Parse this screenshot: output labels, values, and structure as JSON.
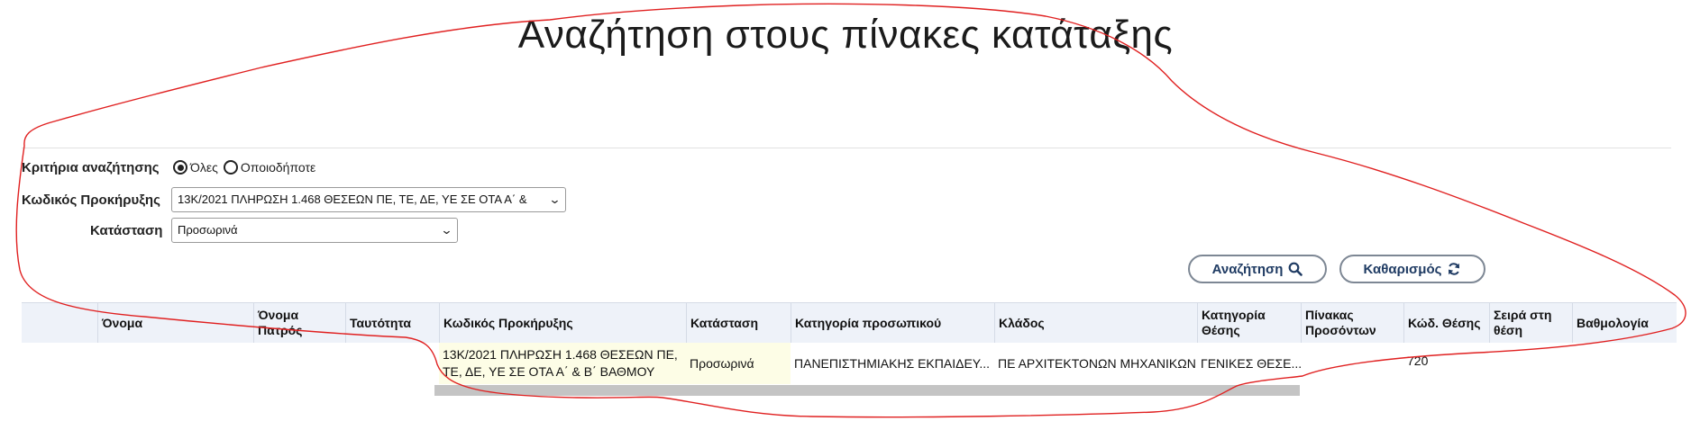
{
  "page": {
    "title": "Αναζήτηση στους πίνακες κατάταξης"
  },
  "form": {
    "criteria_label": "Κριτήρια αναζήτησης",
    "criteria_options": [
      {
        "label": "Όλες",
        "selected": true
      },
      {
        "label": "Οποιοδήποτε",
        "selected": false
      }
    ],
    "announcement_label": "Κωδικός Προκήρυξης",
    "announcement_value": "13Κ/2021 ΠΛΗΡΩΣΗ 1.468 ΘΕΣΕΩΝ ΠΕ, ΤΕ, ΔΕ, ΥΕ ΣΕ ΟΤΑ Α΄ &",
    "status_label": "Κατάσταση",
    "status_value": "Προσωρινά",
    "search_button": "Αναζήτηση",
    "clear_button": "Καθαρισμός"
  },
  "table": {
    "columns": [
      "Όνομα",
      "Όνομα Πατρός",
      "Ταυτότητα",
      "Κωδικός Προκήρυξης",
      "Κατάσταση",
      "Κατηγορία προσωπικού",
      "Κλάδος",
      "Κατηγορία Θέσης",
      "Πίνακας Προσόντων",
      "Κώδ. Θέσης",
      "Σειρά στη θέση",
      "Βαθμολογία"
    ],
    "rows": [
      {
        "name": "",
        "father": "",
        "id": "",
        "announcement": "13Κ/2021 ΠΛΗΡΩΣΗ 1.468 ΘΕΣΕΩΝ ΠΕ, ΤΕ, ΔΕ, ΥΕ ΣΕ ΟΤΑ Α΄ & Β΄ ΒΑΘΜΟΥ",
        "status": "Προσωρινά",
        "staff_category": "ΠΑΝΕΠΙΣΤΗΜΙΑΚΗΣ ΕΚΠΑΙΔΕΥ...",
        "branch": "ΠΕ ΑΡΧΙΤΕΚΤΟΝΩΝ ΜΗΧΑΝΙΚΩΝ",
        "position_category": "ΓΕΝΙΚΕΣ ΘΕΣΕ...",
        "qualifications": "",
        "position_code": "720",
        "rank": "",
        "score": ""
      }
    ]
  },
  "colors": {
    "annotation": "#e02020",
    "highlight": "#f2f51a",
    "header_bg": "#eef2f9",
    "button_text": "#1f3b63"
  }
}
